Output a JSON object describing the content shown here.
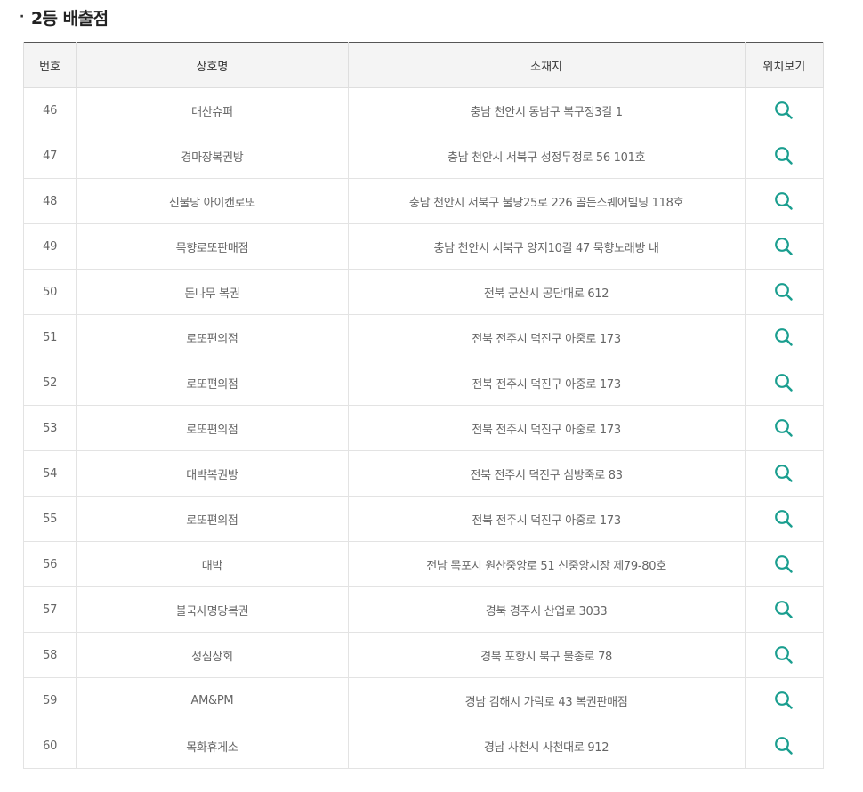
{
  "section": {
    "bullet": "·",
    "title": "2등 배출점"
  },
  "table": {
    "headers": {
      "no": "번호",
      "name": "상호명",
      "address": "소재지",
      "map": "위치보기"
    },
    "rows": [
      {
        "no": "46",
        "name": "대산슈퍼",
        "address": "충남 천안시 동남구 복구정3길 1"
      },
      {
        "no": "47",
        "name": "경마장복권방",
        "address": "충남 천안시 서북구 성정두정로 56 101호"
      },
      {
        "no": "48",
        "name": "신불당 아이캔로또",
        "address": "충남 천안시 서북구 불당25로 226 골든스퀘어빌딩 118호"
      },
      {
        "no": "49",
        "name": "묵향로또판매점",
        "address": "충남 천안시 서북구 양지10길 47 묵향노래방 내"
      },
      {
        "no": "50",
        "name": "돈나무 복권",
        "address": "전북 군산시 공단대로 612"
      },
      {
        "no": "51",
        "name": "로또편의점",
        "address": "전북 전주시 덕진구 아중로 173"
      },
      {
        "no": "52",
        "name": "로또편의점",
        "address": "전북 전주시 덕진구 아중로 173"
      },
      {
        "no": "53",
        "name": "로또편의점",
        "address": "전북 전주시 덕진구 아중로 173"
      },
      {
        "no": "54",
        "name": "대박복권방",
        "address": "전북 전주시 덕진구 심방죽로 83"
      },
      {
        "no": "55",
        "name": "로또편의점",
        "address": "전북 전주시 덕진구 아중로 173"
      },
      {
        "no": "56",
        "name": "대박",
        "address": "전남 목포시 원산중앙로 51 신중앙시장 제79-80호"
      },
      {
        "no": "57",
        "name": "불국사명당복권",
        "address": "경북 경주시 산업로 3033"
      },
      {
        "no": "58",
        "name": "성심상회",
        "address": "경북 포항시 북구 불종로 78"
      },
      {
        "no": "59",
        "name": "AM&PM",
        "address": "경남 김해시 가락로 43 복권판매점"
      },
      {
        "no": "60",
        "name": "목화휴게소",
        "address": "경남 사천시 사천대로 912"
      }
    ]
  },
  "icon": {
    "map": "search-icon",
    "color": "#1a9e8f"
  },
  "colors": {
    "header_bg": "#f4f4f4",
    "border_top": "#555555",
    "cell_border": "#e3e3e3",
    "cell_text": "#666666"
  }
}
